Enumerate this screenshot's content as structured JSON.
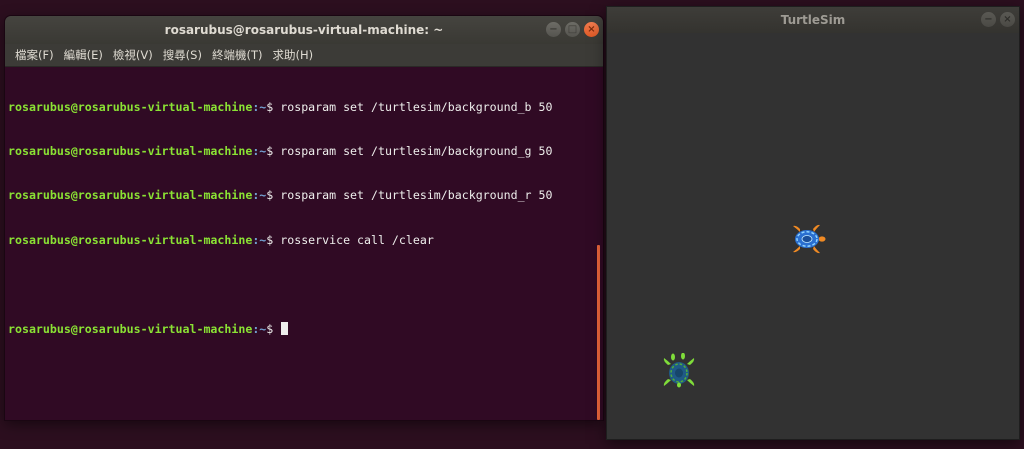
{
  "terminal": {
    "title": "rosarubus@rosarubus-virtual-machine: ~",
    "controls": {
      "minimize": "−",
      "maximize": "□",
      "close": "×"
    },
    "menu": [
      "檔案(F)",
      "編輯(E)",
      "檢視(V)",
      "搜尋(S)",
      "終端機(T)",
      "求助(H)"
    ],
    "prompt_user": "rosarubus@rosarubus-virtual-machine",
    "prompt_path": ":~",
    "prompt_symbol": "$ ",
    "lines": [
      {
        "cmd": "rosparam set /turtlesim/background_b 50"
      },
      {
        "cmd": "rosparam set /turtlesim/background_g 50"
      },
      {
        "cmd": "rosparam set /turtlesim/background_r 50"
      },
      {
        "cmd": "rosservice call /clear"
      },
      {
        "cmd": ""
      }
    ]
  },
  "turtlesim": {
    "title": "TurtleSim",
    "controls": {
      "minimize": "−",
      "close": "×"
    },
    "background_color": "#323232"
  }
}
